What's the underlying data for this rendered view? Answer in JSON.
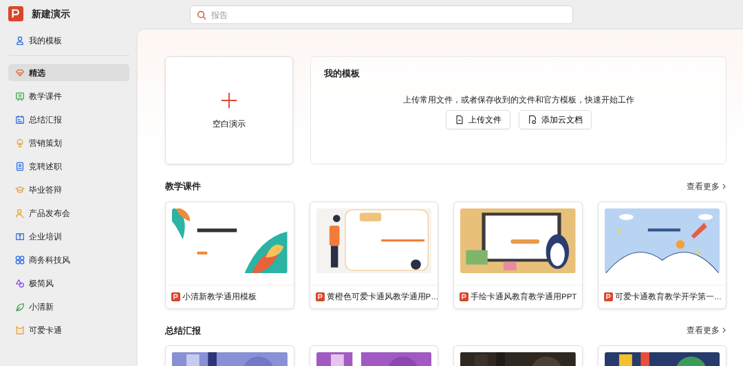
{
  "app": {
    "title": "新建演示"
  },
  "search": {
    "placeholder": "报告"
  },
  "sidebar": {
    "top_item": {
      "label": "我的模板"
    },
    "items": [
      {
        "label": "精选",
        "selected": true
      },
      {
        "label": "教学课件",
        "selected": false
      },
      {
        "label": "总结汇报",
        "selected": false
      },
      {
        "label": "营销策划",
        "selected": false
      },
      {
        "label": "竞聘述职",
        "selected": false
      },
      {
        "label": "毕业答辩",
        "selected": false
      },
      {
        "label": "产品发布会",
        "selected": false
      },
      {
        "label": "企业培训",
        "selected": false
      },
      {
        "label": "商务科技风",
        "selected": false
      },
      {
        "label": "极简风",
        "selected": false
      },
      {
        "label": "小清新",
        "selected": false
      },
      {
        "label": "可爱卡通",
        "selected": false
      }
    ]
  },
  "blank_card": {
    "label": "空白演示"
  },
  "my_templates": {
    "title": "我的模板",
    "description": "上传常用文件，或者保存收到的文件和官方模板，快速开始工作",
    "buttons": [
      {
        "label": "上传文件"
      },
      {
        "label": "添加云文档"
      }
    ]
  },
  "sections": [
    {
      "title": "教学课件",
      "more": "查看更多",
      "cards": [
        {
          "title": "小清新教学通用模板"
        },
        {
          "title": "黄橙色可爱卡通风教学通用P…"
        },
        {
          "title": "手绘卡通风教育教学通用PPT"
        },
        {
          "title": "可爱卡通教育教学开学第一…"
        }
      ]
    },
    {
      "title": "总结汇报",
      "more": "查看更多"
    }
  ]
}
